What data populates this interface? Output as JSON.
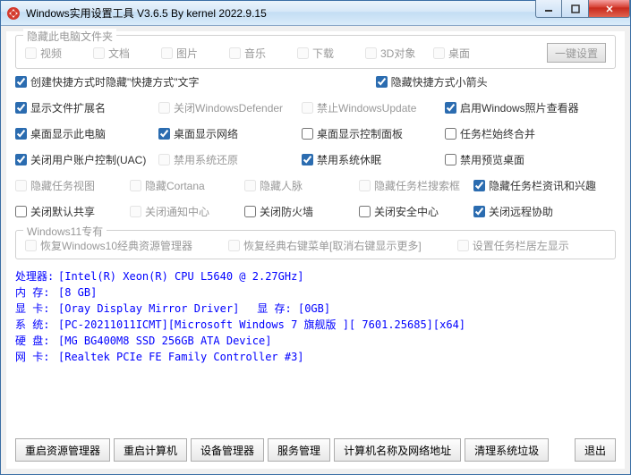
{
  "title": "Windows实用设置工具 V3.6.5 By kernel 2022.9.15",
  "folders": {
    "title": "隐藏此电脑文件夹",
    "items": [
      {
        "label": "视频",
        "checked": false
      },
      {
        "label": "文档",
        "checked": false
      },
      {
        "label": "图片",
        "checked": false
      },
      {
        "label": "音乐",
        "checked": false
      },
      {
        "label": "下载",
        "checked": false
      },
      {
        "label": "3D对象",
        "checked": false
      },
      {
        "label": "桌面",
        "checked": false
      }
    ],
    "button": "一键设置"
  },
  "opts": [
    [
      {
        "label": "创建快捷方式时隐藏\"快捷方式\"文字",
        "checked": true
      },
      {
        "label": "",
        "checked": false,
        "hidden": true
      },
      {
        "label": "隐藏快捷方式小箭头",
        "checked": true
      },
      {
        "label": "",
        "checked": false,
        "hidden": true
      }
    ],
    [
      {
        "label": "显示文件扩展名",
        "checked": true
      },
      {
        "label": "关闭WindowsDefender",
        "checked": false,
        "disabled": true
      },
      {
        "label": "禁止WindowsUpdate",
        "checked": false,
        "disabled": true
      },
      {
        "label": "启用Windows照片查看器",
        "checked": true
      }
    ],
    [
      {
        "label": "桌面显示此电脑",
        "checked": true
      },
      {
        "label": "桌面显示网络",
        "checked": true
      },
      {
        "label": "桌面显示控制面板",
        "checked": false
      },
      {
        "label": "任务栏始终合并",
        "checked": false
      }
    ],
    [
      {
        "label": "关闭用户账户控制(UAC)",
        "checked": true
      },
      {
        "label": "禁用系统还原",
        "checked": false,
        "disabled": true
      },
      {
        "label": "禁用系统休眠",
        "checked": true
      },
      {
        "label": "禁用预览桌面",
        "checked": false
      }
    ],
    [
      {
        "label": "隐藏任务视图",
        "checked": false,
        "disabled": true
      },
      {
        "label": "隐藏Cortana",
        "checked": false,
        "disabled": true
      },
      {
        "label": "隐藏人脉",
        "checked": false,
        "disabled": true
      },
      {
        "label": "隐藏任务栏搜索框",
        "checked": false,
        "disabled": true
      },
      {
        "label": "隐藏任务栏资讯和兴趣",
        "checked": true
      }
    ],
    [
      {
        "label": "关闭默认共享",
        "checked": false
      },
      {
        "label": "关闭通知中心",
        "checked": false,
        "disabled": true
      },
      {
        "label": "关闭防火墙",
        "checked": false
      },
      {
        "label": "关闭安全中心",
        "checked": false
      },
      {
        "label": "关闭远程协助",
        "checked": true
      }
    ]
  ],
  "win11": {
    "title": "Windows11专有",
    "items": [
      {
        "label": "恢复Windows10经典资源管理器"
      },
      {
        "label": "恢复经典右键菜单[取消右键显示更多]"
      },
      {
        "label": "设置任务栏居左显示"
      }
    ]
  },
  "sysinfo": [
    {
      "label": "处理器:",
      "value": "[Intel(R) Xeon(R) CPU           L5640  @ 2.27GHz]"
    },
    {
      "label": "内 存:",
      "value": "[8 GB]"
    },
    {
      "label": "显 卡:",
      "value": "[Oray Display Mirror Driver]",
      "extra_label": "显 存:",
      "extra_value": "[0GB]"
    },
    {
      "label": "系 统:",
      "value": "[PC-20211011ICMT][Microsoft Windows 7 旗舰版 ][ 7601.25685][x64]"
    },
    {
      "label": "硬 盘:",
      "value": "[MG  BG400M8  SSD 256GB ATA Device]"
    },
    {
      "label": "网 卡:",
      "value": "[Realtek PCIe FE Family Controller #3]"
    }
  ],
  "buttons": {
    "b1": "重启资源管理器",
    "b2": "重启计算机",
    "b3": "设备管理器",
    "b4": "服务管理",
    "b5": "计算机名称及网络地址",
    "b6": "清理系统垃圾",
    "exit": "退出"
  }
}
